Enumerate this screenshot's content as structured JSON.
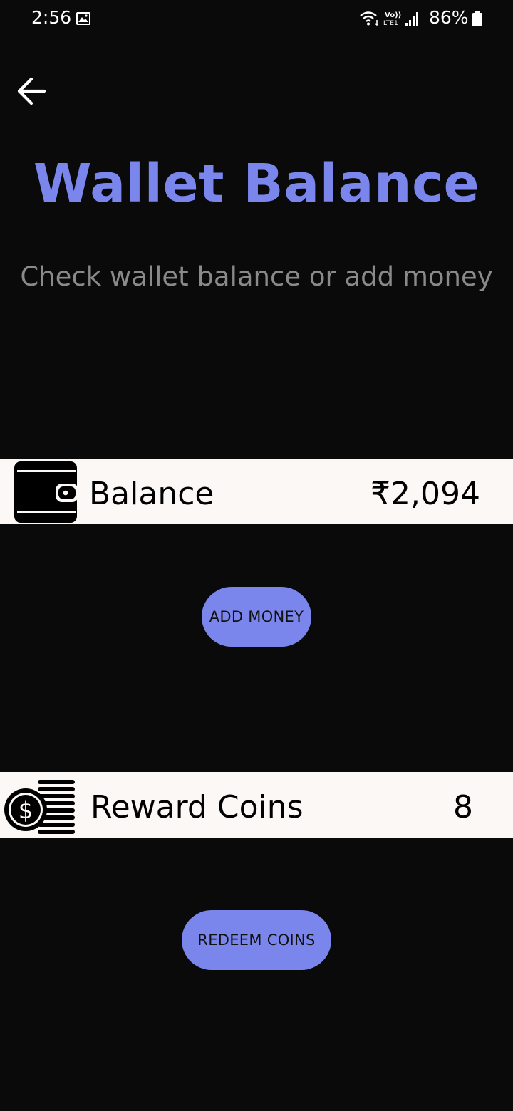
{
  "status_bar": {
    "time": "2:56",
    "network_label": "Vo)) LTE1",
    "battery_percent": "86%",
    "icons": [
      "gallery-icon",
      "wifi-icon",
      "signal-icon",
      "battery-icon"
    ]
  },
  "header": {
    "back_icon": "arrow-left-icon",
    "title": "Wallet Balance",
    "subtitle": "Check wallet balance or add money"
  },
  "wallet": {
    "icon": "wallet-icon",
    "label": "Balance",
    "value": "₹2,094",
    "action_label": "ADD MONEY"
  },
  "rewards": {
    "icon": "coins-icon",
    "label": "Reward Coins",
    "value": "8",
    "action_label": "REDEEM COINS"
  },
  "colors": {
    "background": "#0a0a0b",
    "accent": "#7a86ec",
    "card": "#fcf8f6",
    "subtitle": "#8a8a8a"
  }
}
